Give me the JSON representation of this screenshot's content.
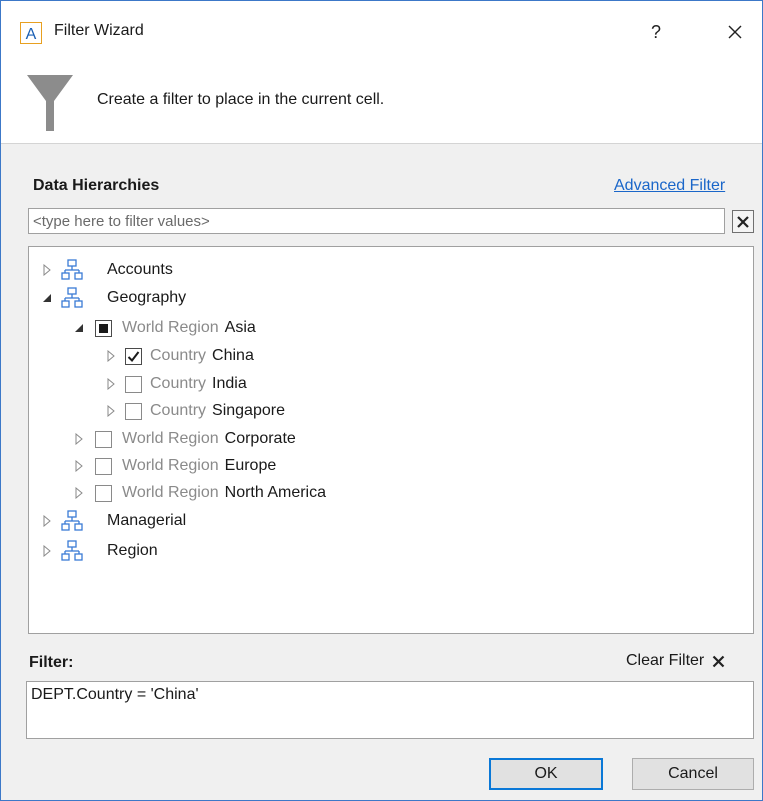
{
  "window": {
    "title": "Filter Wizard",
    "help_label": "?",
    "app_icon_letter": "A"
  },
  "header": {
    "description": "Create a filter to place in the current cell."
  },
  "hierarchies": {
    "label": "Data Hierarchies",
    "advanced_filter_label": "Advanced Filter",
    "search_placeholder": "<type here to filter values>",
    "search_value": ""
  },
  "tree": {
    "accounts": {
      "label": "Accounts"
    },
    "geography": {
      "label": "Geography"
    },
    "asia": {
      "level": "World Region",
      "member": "Asia",
      "state": "partial"
    },
    "china": {
      "level": "Country",
      "member": "China",
      "state": "checked"
    },
    "india": {
      "level": "Country",
      "member": "India",
      "state": "unchecked"
    },
    "singapore": {
      "level": "Country",
      "member": "Singapore",
      "state": "unchecked"
    },
    "corporate": {
      "level": "World Region",
      "member": "Corporate",
      "state": "unchecked"
    },
    "europe": {
      "level": "World Region",
      "member": "Europe",
      "state": "unchecked"
    },
    "north_america": {
      "level": "World Region",
      "member": "North America",
      "state": "unchecked"
    },
    "managerial": {
      "label": "Managerial"
    },
    "region": {
      "label": "Region"
    }
  },
  "filter": {
    "label": "Filter:",
    "clear_label": "Clear Filter",
    "expression": "DEPT.Country = 'China'"
  },
  "buttons": {
    "ok_label": "OK",
    "cancel_label": "Cancel"
  },
  "colors": {
    "accent": "#0a78d7",
    "link": "#1a66c9",
    "level_text": "#8a8a8a",
    "hierarchy_icon": "#3a7bd5"
  }
}
